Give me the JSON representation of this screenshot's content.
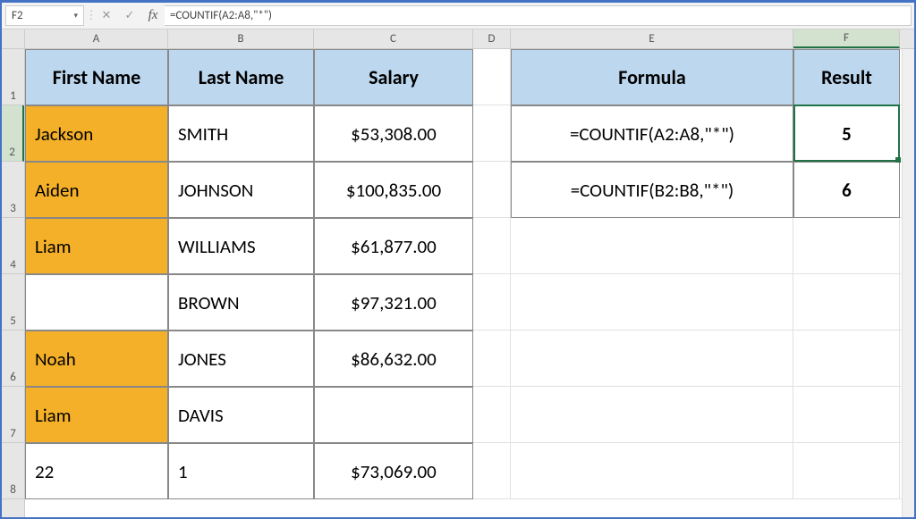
{
  "nameBox": "F2",
  "formulaBar": "=COUNTIF(A2:A8,\"*\")",
  "columns": [
    "A",
    "B",
    "C",
    "D",
    "E",
    "F"
  ],
  "colWidths": {
    "A": 160,
    "B": 163,
    "C": 178,
    "D": 42,
    "E": 316,
    "F": 119
  },
  "rowHeaders": [
    "1",
    "2",
    "3",
    "4",
    "5",
    "6",
    "7",
    "8"
  ],
  "headers": {
    "A": "First Name",
    "B": "Last Name",
    "C": "Salary",
    "E": "Formula",
    "F": "Result"
  },
  "table": [
    {
      "first": "Jackson",
      "last": "SMITH",
      "salary": "$53,308.00"
    },
    {
      "first": "Aiden",
      "last": "JOHNSON",
      "salary": "$100,835.00"
    },
    {
      "first": "Liam",
      "last": "WILLIAMS",
      "salary": "$61,877.00"
    },
    {
      "first": "",
      "last": "BROWN",
      "salary": "$97,321.00"
    },
    {
      "first": "Noah",
      "last": "JONES",
      "salary": "$86,632.00"
    },
    {
      "first": "Liam",
      "last": "DAVIS",
      "salary": ""
    },
    {
      "first": "22",
      "last": "1",
      "salary": "$73,069.00"
    }
  ],
  "orangeRows": [
    0,
    1,
    2,
    4,
    5
  ],
  "formulas": [
    {
      "text": "=COUNTIF(A2:A8,\"*\")",
      "result": "5"
    },
    {
      "text": "=COUNTIF(B2:B8,\"*\")",
      "result": "6"
    }
  ],
  "selection": {
    "cell": "F2"
  },
  "icons": {
    "cancel": "✕",
    "confirm": "✓",
    "dropdown": "▾",
    "fx": "fx"
  },
  "chart_data": null
}
